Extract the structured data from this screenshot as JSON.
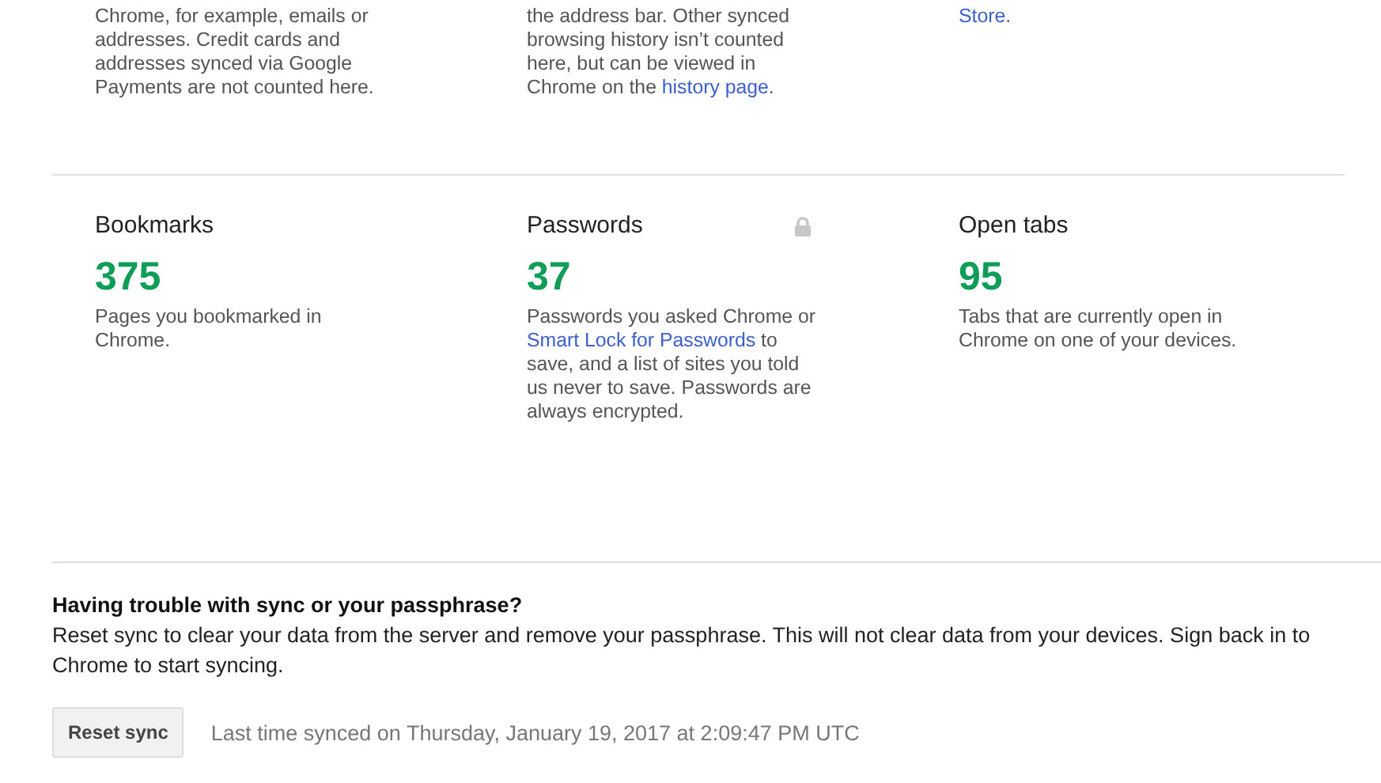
{
  "top_cards": [
    {
      "description": [
        {
          "text": "Chrome, for example, emails or addresses. Credit cards and addresses synced via Google Payments are not counted here.",
          "link": false
        }
      ]
    },
    {
      "description": [
        {
          "text": "the address bar. Other synced browsing history isn’t counted here, but can be viewed in Chrome on the ",
          "link": false
        },
        {
          "text": "history page",
          "link": true
        },
        {
          "text": ".",
          "link": false
        }
      ]
    },
    {
      "description": [
        {
          "text": "Store",
          "link": true
        },
        {
          "text": ".",
          "link": false
        }
      ]
    }
  ],
  "cards": [
    {
      "title": "Bookmarks",
      "count": "375",
      "locked": false,
      "description": [
        {
          "text": "Pages you bookmarked in Chrome.",
          "link": false
        }
      ]
    },
    {
      "title": "Passwords",
      "count": "37",
      "locked": true,
      "description": [
        {
          "text": "Passwords you asked Chrome or ",
          "link": false
        },
        {
          "text": "Smart Lock for Passwords",
          "link": true
        },
        {
          "text": " to save, and a list of sites you told us never to save. Passwords are always encrypted.",
          "link": false
        }
      ]
    },
    {
      "title": "Open tabs",
      "count": "95",
      "locked": false,
      "description": [
        {
          "text": "Tabs that are currently open in Chrome on one of your devices.",
          "link": false
        }
      ]
    }
  ],
  "trouble": {
    "heading": "Having trouble with sync or your passphrase?",
    "text": "Reset sync to clear your data from the server and remove your passphrase. This will not clear data from your devices. Sign back in to Chrome to start syncing.",
    "button": "Reset sync",
    "last_synced": "Last time synced on Thursday, January 19, 2017 at 2:09:47 PM UTC"
  }
}
